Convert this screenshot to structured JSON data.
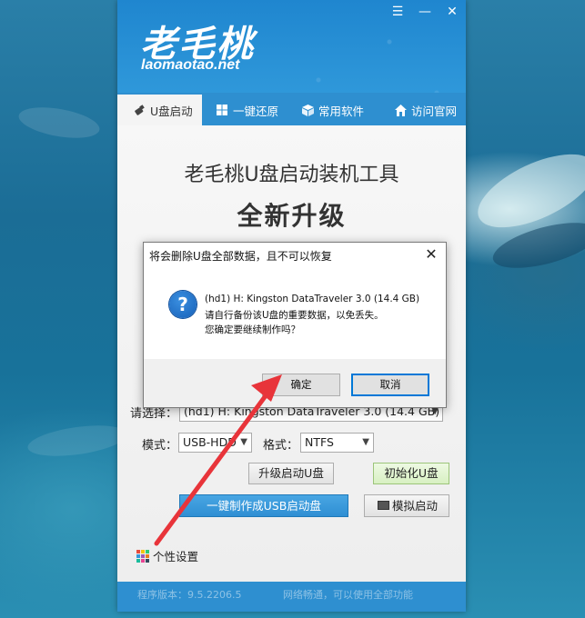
{
  "app": {
    "logo_cn": "老毛桃",
    "logo_en": "laomaotao.net",
    "controls": {
      "menu": "☰",
      "minimize": "—",
      "close": "✕"
    },
    "tabs": [
      {
        "label": "U盘启动",
        "icon": "usb-icon",
        "active": true
      },
      {
        "label": "一键还原",
        "icon": "windows-icon",
        "active": false
      },
      {
        "label": "常用软件",
        "icon": "box-icon",
        "active": false
      },
      {
        "label": "访问官网",
        "icon": "home-icon",
        "active": false
      }
    ],
    "headline": "老毛桃U盘启动装机工具",
    "subheadline": "全新升级",
    "form": {
      "select_label": "请选择：",
      "device_value": "(hd1) H: Kingston DataTraveler 3.0 (14.4 GB)",
      "mode_label": "模式：",
      "mode_value": "USB-HDD",
      "format_label": "格式：",
      "format_value": "NTFS",
      "upgrade_button": "升级启动U盘",
      "init_button": "初始化U盘",
      "make_button": "一键制作成USB启动盘",
      "simulate_button": "模拟启动",
      "personalize": "个性设置"
    },
    "footer": {
      "version": "程序版本：9.5.2206.5",
      "network": "网络畅通，可以使用全部功能"
    }
  },
  "dialog": {
    "title": "将会删除U盘全部数据，且不可以恢复",
    "icon": "question-icon",
    "lines": [
      "(hd1) H: Kingston DataTraveler 3.0 (14.4 GB)",
      "请自行备份该U盘的重要数据，以免丢失。",
      "您确定要继续制作吗？"
    ],
    "ok_label": "确定",
    "cancel_label": "取消"
  },
  "annotation": {
    "arrow_color": "#e8343a"
  }
}
